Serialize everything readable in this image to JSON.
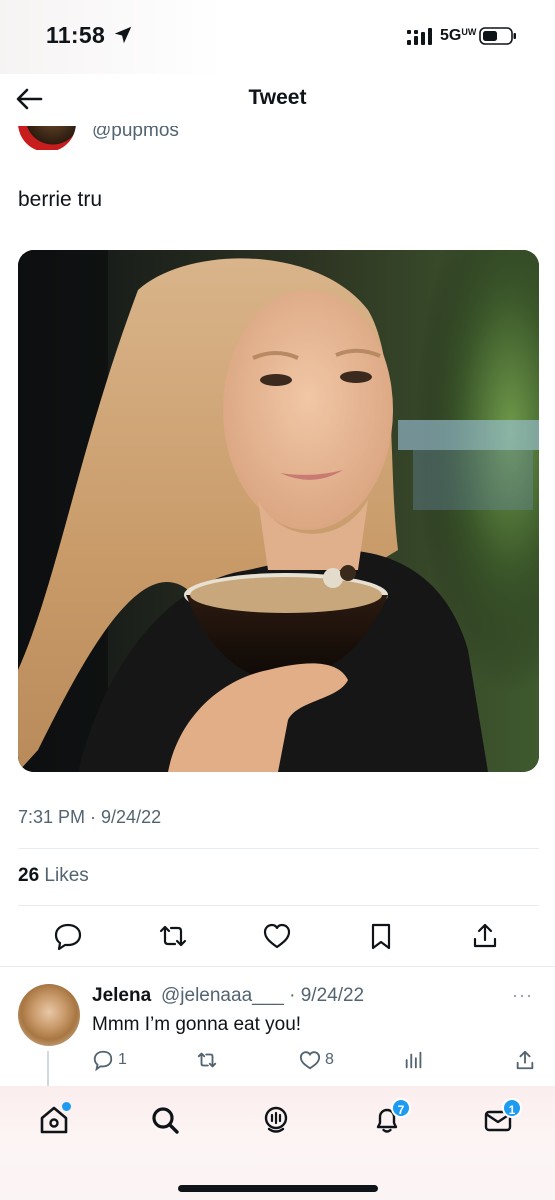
{
  "status_bar": {
    "time": "11:58",
    "network": "5G",
    "network_sub": "UW",
    "icons": [
      "location-arrow-icon",
      "signal-icon",
      "battery-icon"
    ]
  },
  "nav": {
    "title": "Tweet",
    "back_icon": "back-arrow-icon"
  },
  "tweet": {
    "author_handle": "@pupmos",
    "text": "berrie tru",
    "photo_description_icon": "photo",
    "timestamp": "7:31 PM · 9/24/22",
    "likes_count": "26",
    "likes_label": "Likes",
    "actions": [
      "reply-icon",
      "retweet-icon",
      "like-icon",
      "bookmark-icon",
      "share-icon"
    ]
  },
  "reply": {
    "name": "Jelena",
    "handle": "@jelenaaa___ · 9/24/22",
    "more": "···",
    "text": "Mmm I’m gonna eat you!",
    "reply_count": "1",
    "like_count": "8"
  },
  "tab_bar": {
    "items": [
      "home-icon",
      "search-icon",
      "spaces-icon",
      "notifications-icon",
      "messages-icon"
    ],
    "notifications_badge": "7",
    "messages_badge": "1"
  },
  "colors": {
    "accent": "#1d9bf0",
    "text": "#0f1419",
    "muted": "#536471"
  }
}
